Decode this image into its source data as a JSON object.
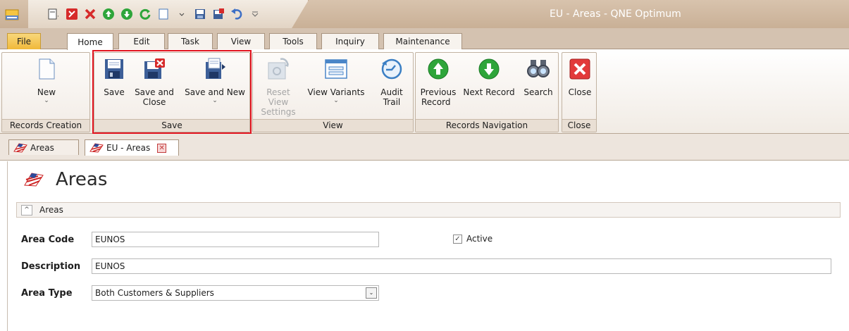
{
  "window": {
    "title": "EU - Areas - QNE Optimum"
  },
  "qat": {
    "icons": [
      "new-doc-dropdown-icon",
      "delete-icon",
      "cancel-icon",
      "previous-icon",
      "next-icon",
      "refresh-icon",
      "new-icon",
      "save-icon",
      "save-and-close-icon",
      "undo-icon",
      "customize-qat-icon"
    ]
  },
  "ribbon_tabs": [
    "File",
    "Home",
    "Edit",
    "Task",
    "View",
    "Tools",
    "Inquiry",
    "Maintenance"
  ],
  "ribbon": {
    "groups": {
      "records_creation": "Records Creation",
      "save": "Save",
      "view": "View",
      "records_navigation": "Records Navigation",
      "close": "Close"
    },
    "buttons": {
      "new": "New",
      "save": "Save",
      "save_and_close_1": "Save and",
      "save_and_close_2": "Close",
      "save_and_new": "Save and New",
      "reset_view_1": "Reset View",
      "reset_view_2": "Settings",
      "view_variants": "View Variants",
      "audit_trail_1": "Audit",
      "audit_trail_2": "Trail",
      "previous_record_1": "Previous",
      "previous_record_2": "Record",
      "next_record": "Next Record",
      "search": "Search",
      "close": "Close"
    },
    "caret": "⌄"
  },
  "doc_tabs": [
    {
      "label": "Areas"
    },
    {
      "label": "EU - Areas"
    }
  ],
  "page": {
    "heading": "Areas",
    "section_title": "Areas",
    "collapse_glyph": "^"
  },
  "form": {
    "area_code_label": "Area Code",
    "area_code_value": "EUNOS",
    "active_label": "Active",
    "active_check": "✓",
    "description_label": "Description",
    "description_value": "EUNOS",
    "area_type_label": "Area Type",
    "area_type_value": "Both Customers & Suppliers",
    "dropdown_glyph": "⌄"
  },
  "colors": {
    "accent_red": "#e2141f",
    "title_text": "#ffffff",
    "file_tab": "#f0b93a"
  }
}
